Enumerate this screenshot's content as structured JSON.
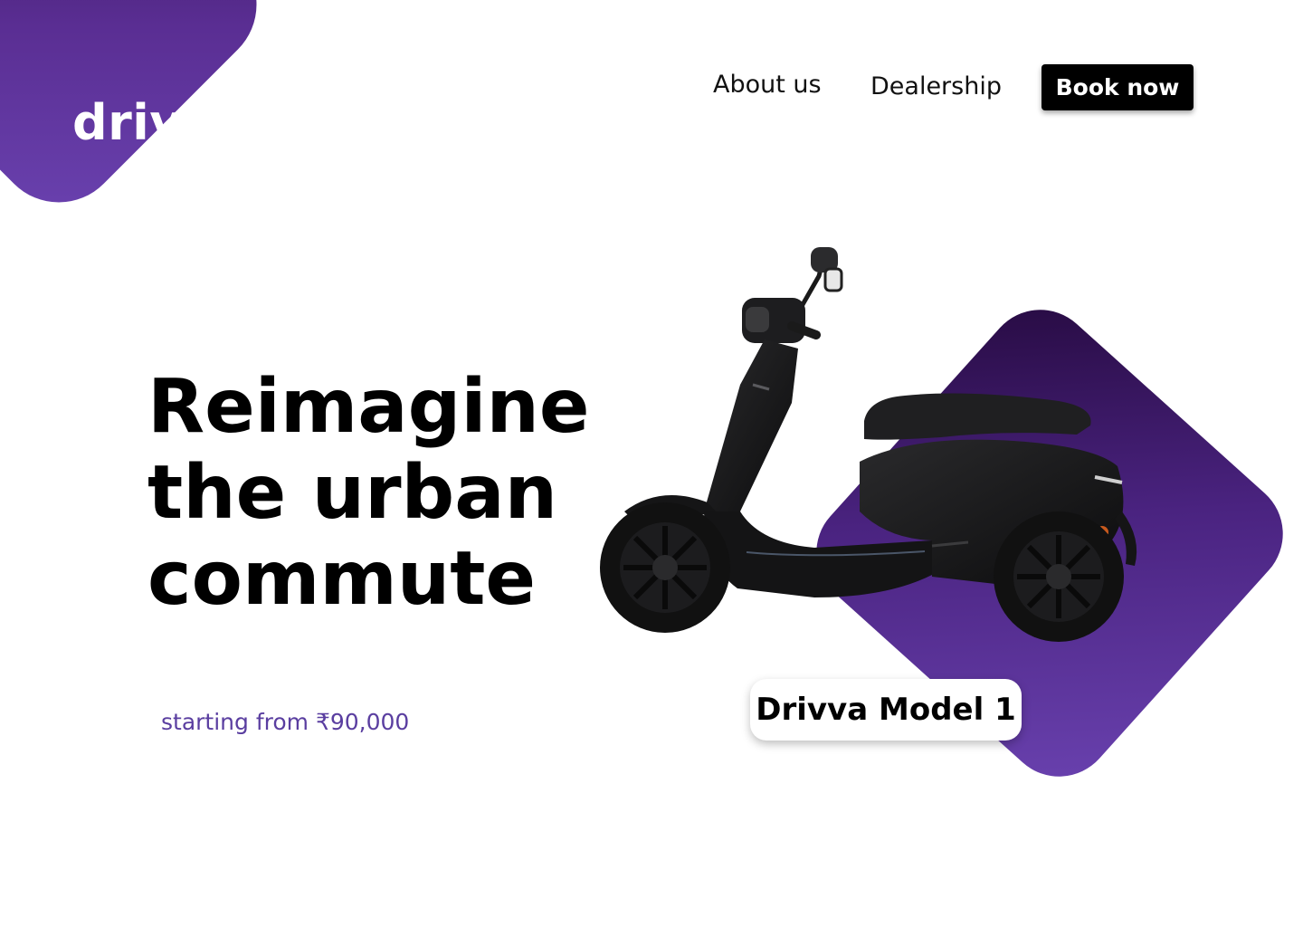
{
  "brand": {
    "logo_text": "drivva"
  },
  "nav": {
    "about_label": "About us",
    "dealership_label": "Dealership",
    "book_label": "Book now"
  },
  "hero": {
    "headline_lines": [
      "Reimagine",
      "the urban",
      "commute"
    ],
    "price_text": "starting from ₹90,000",
    "model_name": "Drivva Model 1"
  },
  "colors": {
    "brand_purple": "#5a2e93",
    "brand_purple_dark": "#2e0e4c",
    "price_text": "#5a3ea0",
    "cta_bg": "#000000"
  },
  "icons": {
    "product_image": "electric-scooter"
  }
}
